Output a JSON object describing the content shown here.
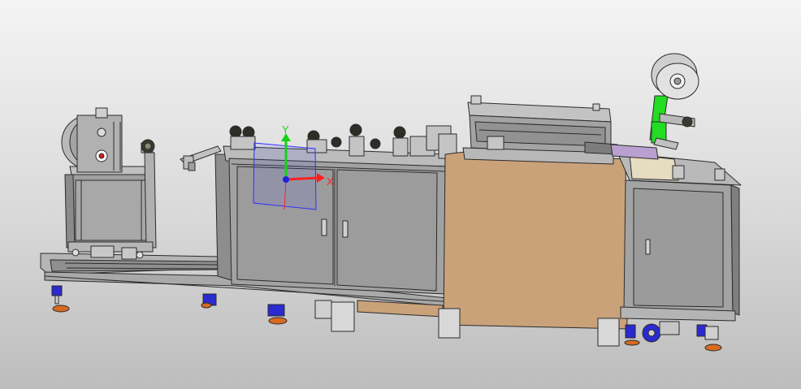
{
  "viewport": {
    "background_top": "#f4f4f4",
    "background_bottom": "#bdbdbd"
  },
  "triad": {
    "x_label": "X",
    "y_label": "Y",
    "x_color": "#ff2020",
    "y_color": "#18d018",
    "z_color": "#2020e0",
    "plane_color": "#3030ff"
  },
  "colors": {
    "frame_gray": "#a6a6a6",
    "panel_gray": "#9d9d9d",
    "edge": "#2b2b2b",
    "tan_guard": "#c9a27a",
    "green_bracket": "#22dd22",
    "foot_orange": "#d86a20",
    "foot_blue": "#2a2ad0",
    "label_tan": "#e6dcc0"
  }
}
